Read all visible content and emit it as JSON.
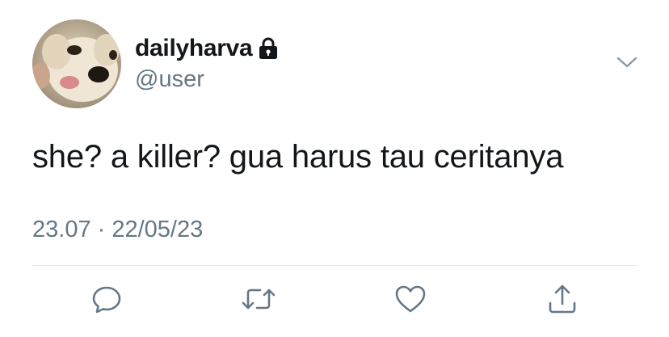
{
  "tweet": {
    "display_name": "dailyharva",
    "handle": "@user",
    "text": "she? a killer? gua harus tau ceritanya",
    "timestamp": "23.07 · 22/05/23",
    "protected": true
  },
  "icons": {
    "lock": "lock-icon",
    "menu": "chevron-down-icon",
    "reply": "reply-icon",
    "retweet": "retweet-icon",
    "like": "heart-icon",
    "share": "share-icon"
  },
  "colors": {
    "text_primary": "#14171a",
    "text_secondary": "#657786",
    "divider": "#e1e8ed",
    "icon": "#657786"
  }
}
